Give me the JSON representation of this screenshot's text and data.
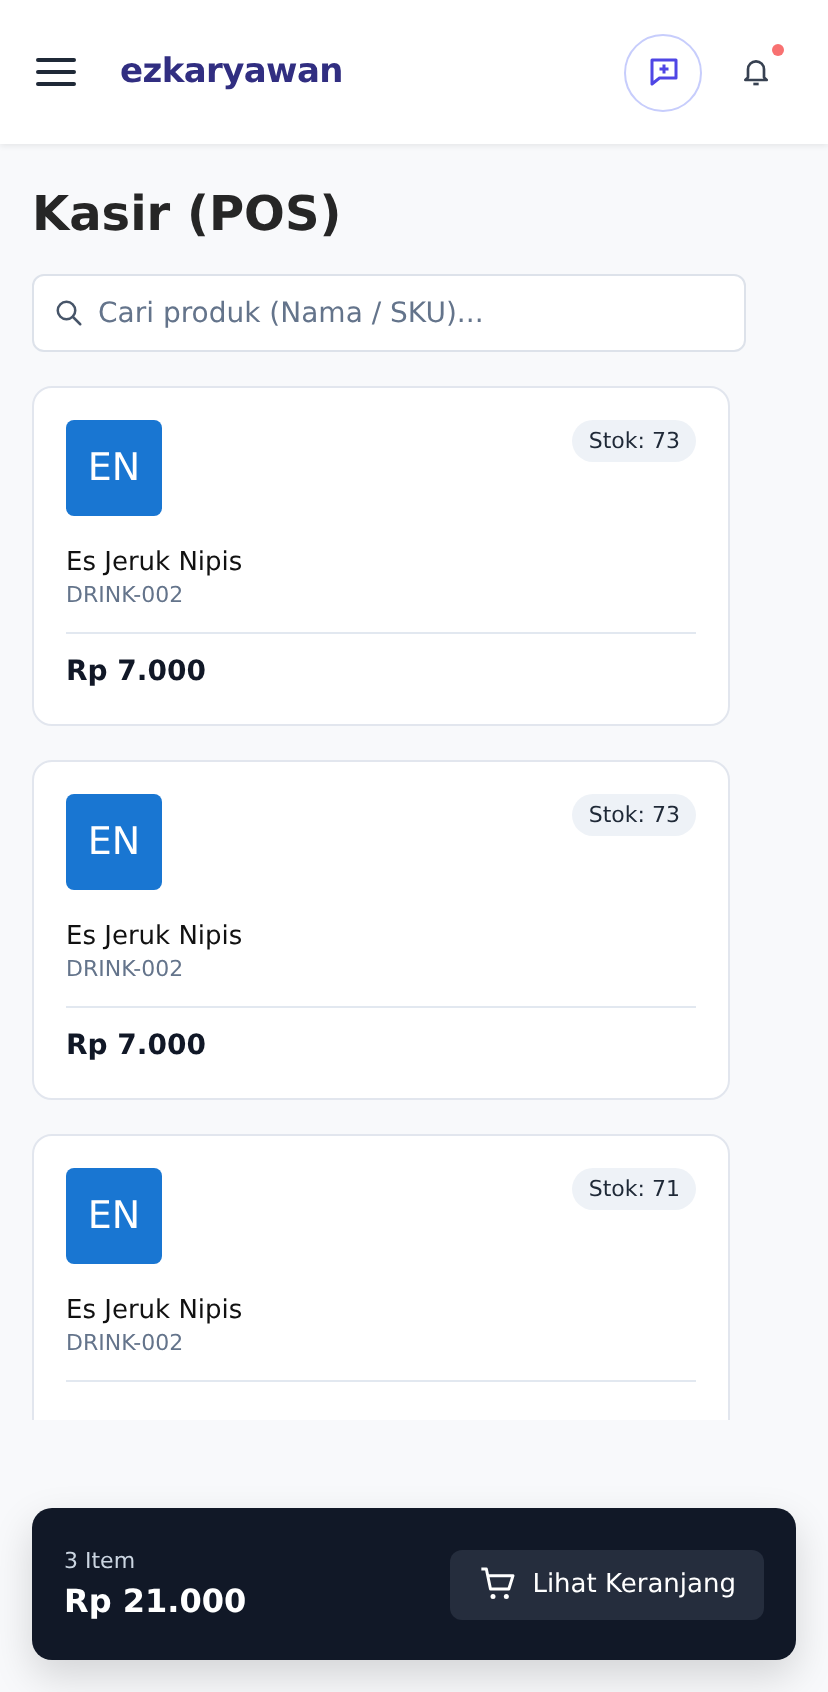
{
  "header": {
    "brand": "ezkaryawan",
    "notification_unread": true
  },
  "page_title": "Kasir (POS)",
  "search": {
    "placeholder": "Cari produk (Nama / SKU)..."
  },
  "products": [
    {
      "initials": "EN",
      "color": "#1976d2",
      "stock": "Stok: 73",
      "name": "Es Jeruk Nipis",
      "sku": "DRINK-002",
      "price": "Rp 7.000"
    },
    {
      "initials": "EN",
      "color": "#1976d2",
      "stock": "Stok: 73",
      "name": "Es Jeruk Nipis",
      "sku": "DRINK-002",
      "price": "Rp 7.000"
    },
    {
      "initials": "EN",
      "color": "#1976d2",
      "stock": "Stok: 71",
      "name": "Es Jeruk Nipis",
      "sku": "DRINK-002"
    }
  ],
  "cart": {
    "count": "3 Item",
    "total": "Rp 21.000",
    "button": "Lihat Keranjang"
  }
}
